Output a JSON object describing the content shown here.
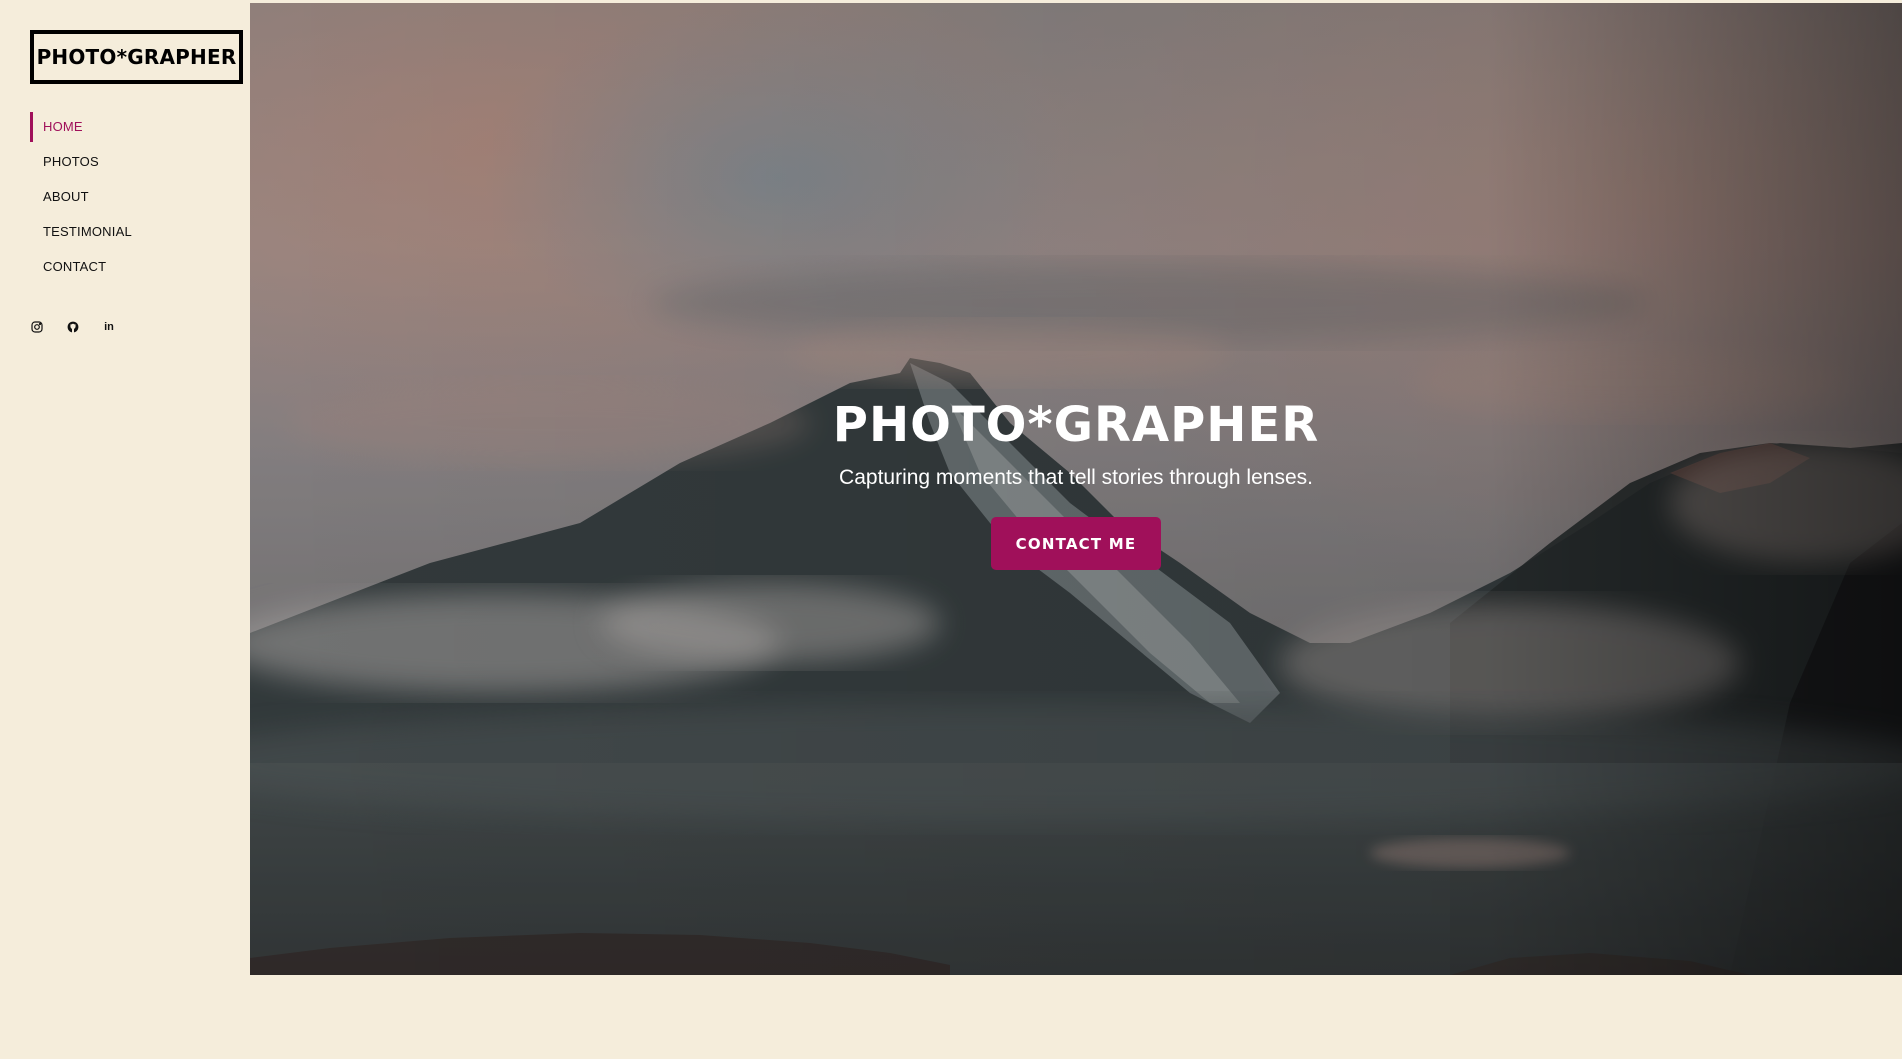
{
  "brand": {
    "logo_text": "PHOTO*GRAPHER"
  },
  "nav": {
    "items": [
      {
        "label": "HOME",
        "active": true
      },
      {
        "label": "PHOTOS",
        "active": false
      },
      {
        "label": "ABOUT",
        "active": false
      },
      {
        "label": "TESTIMONIAL",
        "active": false
      },
      {
        "label": "CONTACT",
        "active": false
      }
    ]
  },
  "socials": [
    {
      "icon": "instagram-icon"
    },
    {
      "icon": "github-icon"
    },
    {
      "icon": "linkedin-icon",
      "glyph": "in"
    }
  ],
  "hero": {
    "title": "PHOTO*GRAPHER",
    "subtitle": "Capturing moments that tell stories through lenses.",
    "cta_label": "CONTACT ME",
    "background_image": "misty-mountain-peak"
  },
  "colors": {
    "accent": "#a0105a",
    "page_bg": "#f5eddb",
    "text": "#111111"
  }
}
